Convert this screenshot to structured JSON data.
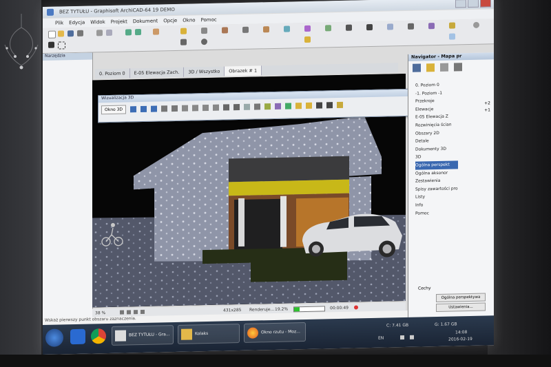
{
  "window": {
    "title": "BEZ TYTUŁU - Graphisoft ArchiCAD-64 19 DEMO"
  },
  "menu": [
    "Plik",
    "Edycja",
    "Widok",
    "Projekt",
    "Dokument",
    "Opcje",
    "Okno",
    "Pomoc"
  ],
  "left_panel": {
    "title": "Narzędzia"
  },
  "tabs": [
    "0. Poziom 0",
    "E-05 Elewacja Zach.",
    "3D / Wszystko",
    "Obrazek # 1"
  ],
  "vis3d": {
    "title": "Wizualizacja 3D",
    "button": "Okno 3D"
  },
  "viewport_status": {
    "zoom": "38 %",
    "resolution": "431x285",
    "rendering_label": "Renderuje...",
    "rendering_percent": "19.2%",
    "progress": 0.192,
    "time": "00:00:49"
  },
  "hint": "Wskaż pierwszy punkt obszaru zaznaczenia.",
  "navigator": {
    "title": "Navigator - Mapa pr",
    "items": [
      "0. Poziom 0",
      "-1. Poziom -1",
      "Przekroje",
      "Elewacje",
      "E-05 Elewacja Z",
      "Rozwinięcia ścian",
      "Obszary 2D",
      "Detale",
      "Dokumenty 3D",
      "3D",
      "Ogólna perspekt",
      "Ogólna aksonor",
      "Zestawienia",
      "Spisy zawartości pro",
      "Listy",
      "Info",
      "Pomoc"
    ],
    "selected_index": 10,
    "level_markers": [
      "+2",
      "+1"
    ],
    "props_label": "Cechy",
    "props_value": "Ogólna perspektywa",
    "settings_button": "Ustawienia..."
  },
  "taskbar": {
    "tasks": [
      "BEZ TYTUŁU - Gra...",
      "Kolaks",
      "Okno rzutu - Moz..."
    ],
    "disk_c": "C: 7.41 GB",
    "disk_g": "G: 1.67 GB",
    "lang": "EN",
    "time": "14:08",
    "date": "2016-02-19"
  },
  "colors": {
    "taskbar": "#22304a",
    "accent": "#3a68b0",
    "progress": "#2ec22e",
    "close": "#c84a3f"
  }
}
